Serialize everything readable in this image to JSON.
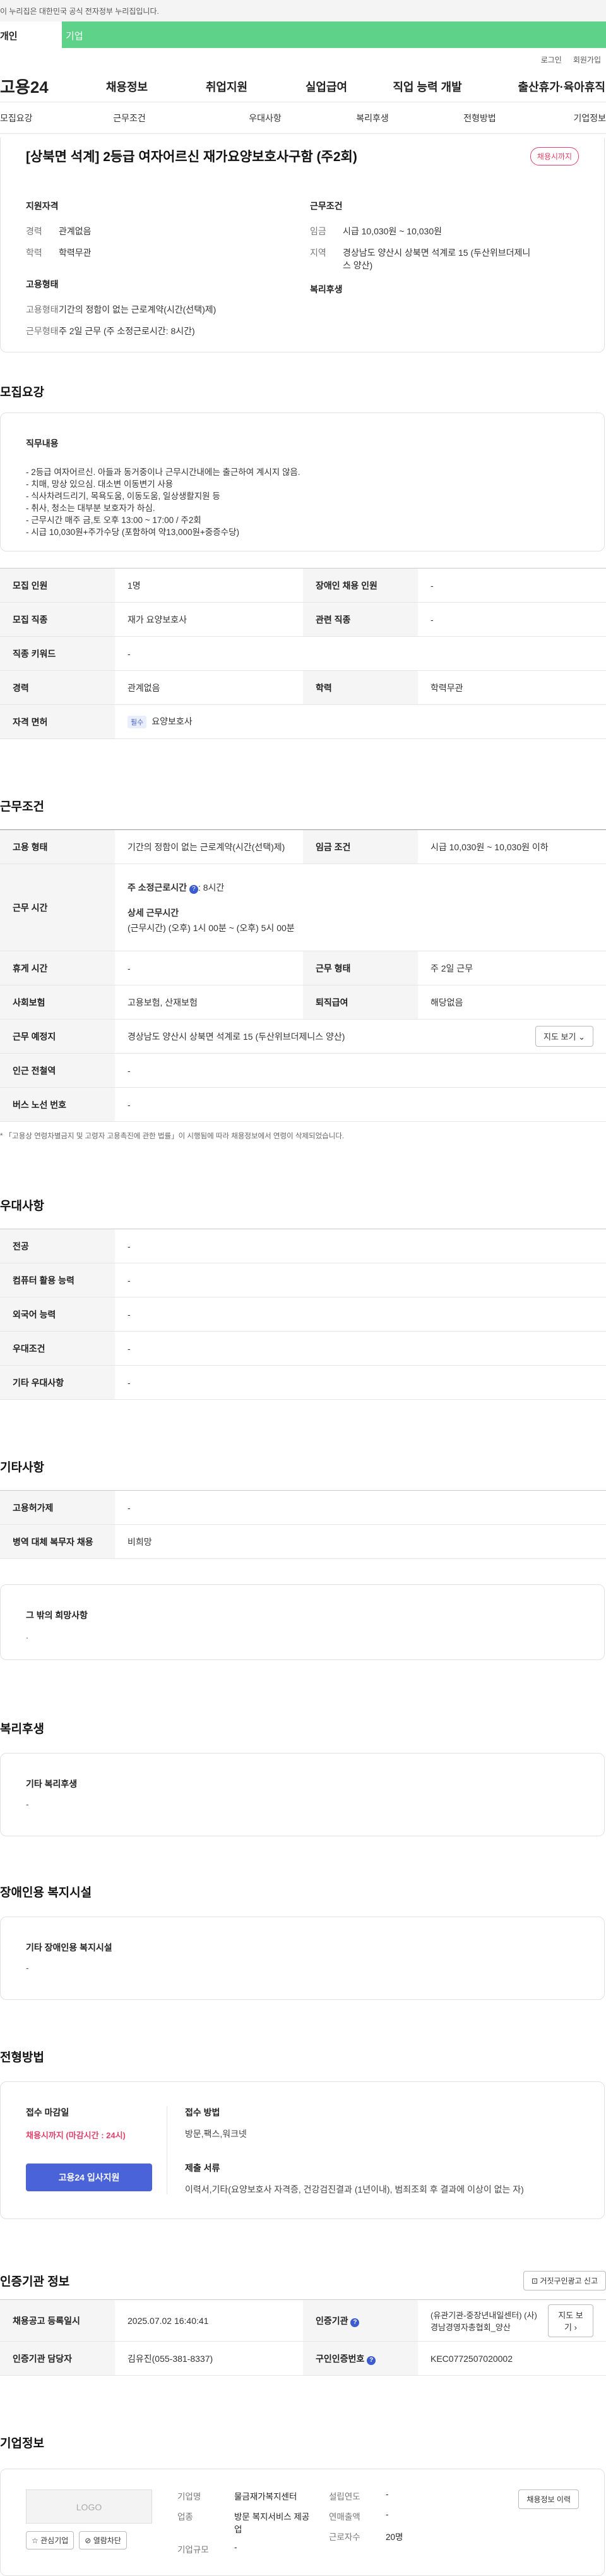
{
  "gov_banner": "이 누리집은 대한민국 공식 전자정부 누리집입니다.",
  "top_tabs": {
    "personal": "개인",
    "business": "기업"
  },
  "util": {
    "login": "로그인",
    "join": "회원가입"
  },
  "logo": "고용24",
  "gnb": [
    "채용정보",
    "취업지원",
    "실업급여",
    "직업 능력 개발",
    "출산휴가·육아휴직"
  ],
  "snb": [
    "모집요강",
    "근무조건",
    "우대사항",
    "복리후생",
    "전형방법",
    "기업정보"
  ],
  "job": {
    "title": "[상북면 석계] 2등급 여자어르신 재가요양보호사구함 (주2회)",
    "deadline_badge": "채용시까지",
    "qual_title": "지원자격",
    "career_k": "경력",
    "career_v": "관계없음",
    "edu_k": "학력",
    "edu_v": "학력무관",
    "work_title": "근무조건",
    "wage_k": "임금",
    "wage_v": "시급 10,030원 ~ 10,030원",
    "area_k": "지역",
    "area_v": "경상남도 양산시 상북면 석계로 15 (두산위브더제니스 양산)",
    "emp_title": "고용형태",
    "emptype_k": "고용형태",
    "emptype_v": "기간의 정함이 없는 근로계약(시간(선택)제)",
    "worktype_k": "근무형태",
    "worktype_v": "주 2일 근무 (주 소정근로시간: 8시간)",
    "welfare_title": "복리후생"
  },
  "recruit": {
    "section": "모집요강",
    "duty_title": "직무내용",
    "duty_lines": [
      "- 2등급 여자어르신. 아들과 동거중이나 근무시간내에는 출근하여 계시지 않음.",
      "- 치매, 망상 있으심. 대소변 이동변기 사용",
      "- 식사차려드리기, 목욕도움, 이동도움, 일상생활지원 등",
      "- 취사, 청소는 대부분 보호자가 하심.",
      "- 근무시간 매주 금,토 오후 13:00 ~ 17:00 / 주2회",
      "- 시급 10,030원+주가수당 (포함하여 약13,000원+중증수당)"
    ],
    "rows": [
      {
        "k1": "모집 인원",
        "v1": "1명",
        "k2": "장애인 채용 인원",
        "v2": "-"
      },
      {
        "k1": "모집 직종",
        "v1": "재가 요양보호사",
        "k2": "관련 직종",
        "v2": "-"
      },
      {
        "k1": "직종 키워드",
        "v1": "-"
      },
      {
        "k1": "경력",
        "v1": "관계없음",
        "k2": "학력",
        "v2": "학력무관"
      },
      {
        "k1": "자격 면허",
        "chip": "필수",
        "v1": "요양보호사"
      }
    ]
  },
  "cond": {
    "section": "근무조건",
    "emp_k": "고용 형태",
    "emp_v": "기간의 정함이 없는 근로계약(시간(선택)제)",
    "wage_k": "임금 조건",
    "wage_v": "시급 10,030원 ~ 10,030원 이하",
    "time_k": "근무 시간",
    "time_week_label": "주 소정근로시간",
    "time_week_value": ": 8시간",
    "time_detail_label": "상세 근무시간",
    "time_detail_value": "(근무시간) (오후) 1시 00분 ~ (오후) 5시 00분",
    "rest_k": "휴게 시간",
    "rest_v": "-",
    "form_k": "근무 형태",
    "form_v": "주 2일 근무",
    "ins_k": "사회보험",
    "ins_v": "고용보험, 산재보험",
    "sev_k": "퇴직급여",
    "sev_v": "해당없음",
    "place_k": "근무 예정지",
    "place_v": "경상남도 양산시 상북면 석계로 15 (두산위브더제니스 양산)",
    "map_btn": "지도 보기",
    "subway_k": "인근 전철역",
    "subway_v": "-",
    "bus_k": "버스 노선 번호",
    "bus_v": "-",
    "note": "* 「고용상 연령차별금지 및 고령자 고용촉진에 관한 법률」이 시행됨에 따라 채용정보에서 연령이 삭제되었습니다."
  },
  "pref": {
    "section": "우대사항",
    "rows": [
      [
        "전공",
        "-"
      ],
      [
        "컴퓨터 활용 능력",
        "-"
      ],
      [
        "외국어 능력",
        "-"
      ],
      [
        "우대조건",
        "-"
      ],
      [
        "기타 우대사항",
        "-"
      ]
    ]
  },
  "etc": {
    "section": "기타사항",
    "rows": [
      [
        "고용허가제",
        "-"
      ],
      [
        "병역 대체 복무자 채용",
        "비희망"
      ]
    ],
    "other_title": "그 밖의 희망사항",
    "other_v": "."
  },
  "welfare": {
    "section": "복리후생",
    "title": "기타 복리후생",
    "v": "-"
  },
  "disab": {
    "section": "장애인용 복지시설",
    "title": "기타 장애인용 복지시설",
    "v": "-"
  },
  "select": {
    "section": "전형방법",
    "deadline_k": "접수 마감일",
    "deadline_v": "채용시까지 (마감시간 : 24시)",
    "apply_btn": "고용24 입사지원",
    "method_k": "접수 방법",
    "method_v": "방문,팩스,워크넷",
    "docs_k": "제출 서류",
    "docs_v": "이력서,기타(요양보호사 자격증, 건강검진결과 (1년이내), 범죄조회 후 결과에 이상이 없는 자)"
  },
  "cert": {
    "section": "인증기관 정보",
    "report_btn": "거짓구인광고 신고",
    "reg_k": "채용공고 등록일시",
    "reg_v": "2025.07.02 16:40:41",
    "org_k": "인증기관",
    "org_v": "(유관기관-중장년내일센터) (사)경남경영자총협회_양산",
    "map_btn": "지도 보기",
    "mgr_k": "인증기관 담당자",
    "mgr_v": "김유진(055-381-8337)",
    "no_k": "구인인증번호",
    "no_v": "KEC0772507020002"
  },
  "company": {
    "section": "기업정보",
    "logo": "LOGO",
    "fav_btn": "관심기업",
    "block_btn": "열람차단",
    "name_k": "기업명",
    "name_v": "물금재가복지센터",
    "ind_k": "업종",
    "ind_v": "방문 복지서비스 제공업",
    "size_k": "기업규모",
    "size_v": "-",
    "est_k": "설립연도",
    "est_v": "-",
    "sales_k": "연매출액",
    "sales_v": "-",
    "emp_k": "근로자수",
    "emp_v": "20명",
    "more_btn": "채용정보 이력"
  }
}
